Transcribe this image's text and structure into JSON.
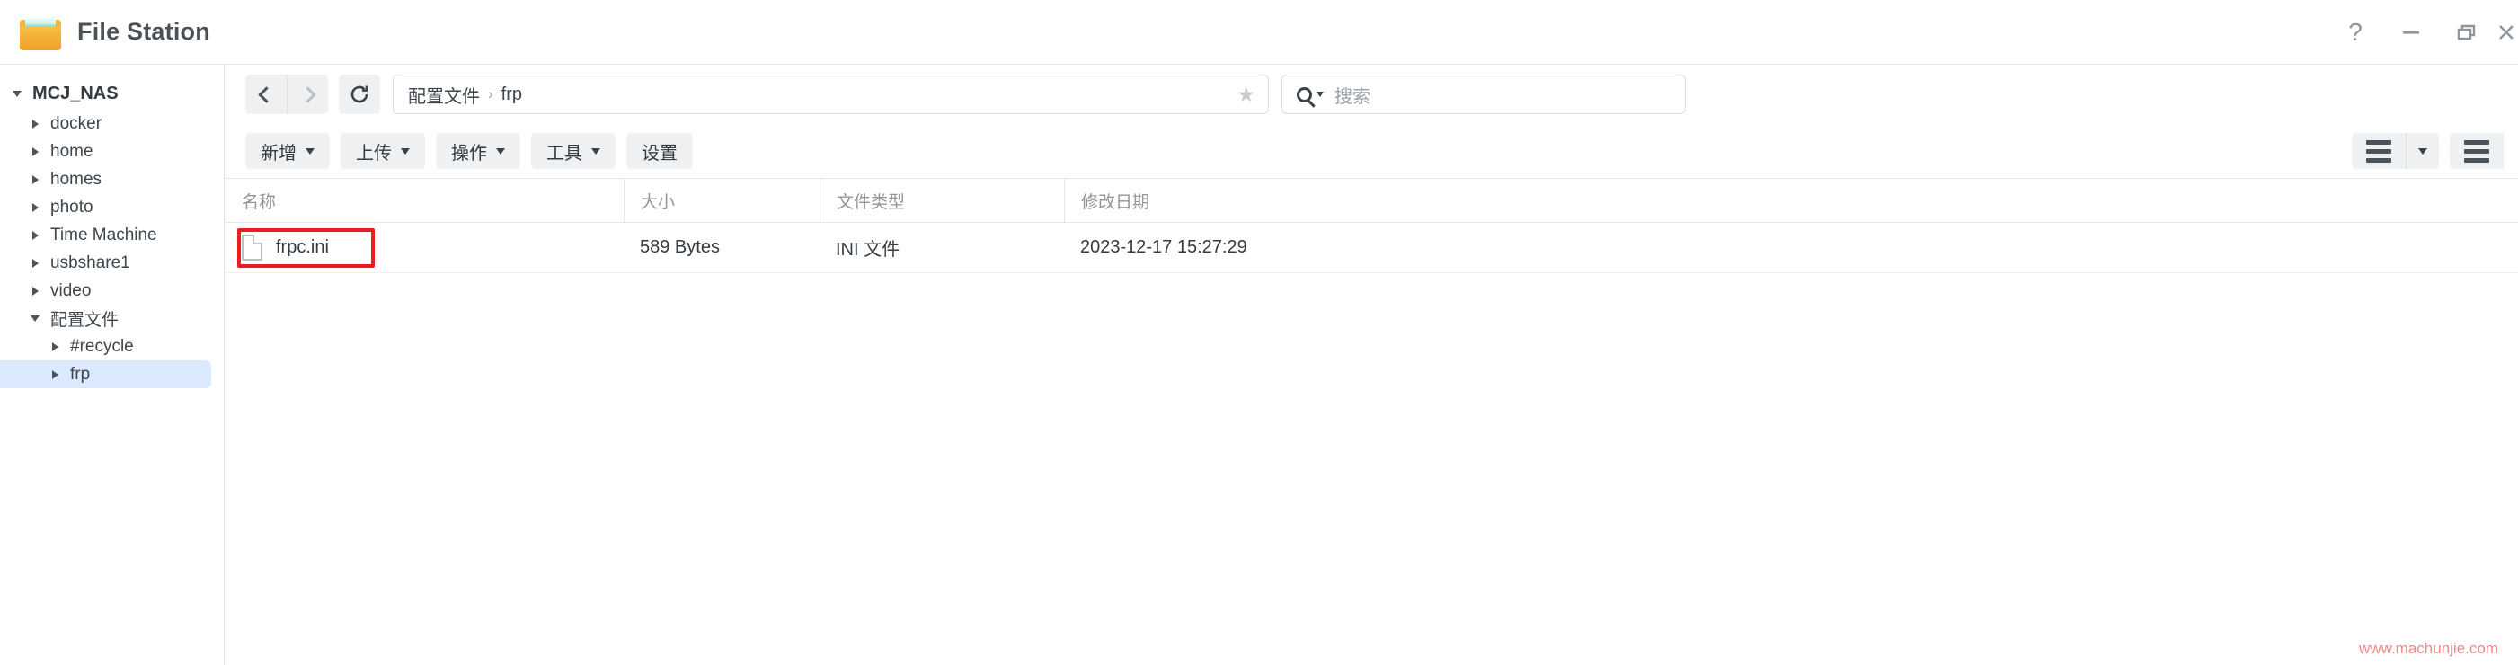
{
  "window": {
    "title": "File Station",
    "app_icon": "folder-icon",
    "controls": [
      {
        "name": "help-button",
        "glyph": "?"
      },
      {
        "name": "minimize-button",
        "glyph": "—"
      },
      {
        "name": "restore-button",
        "glyph": "restore"
      },
      {
        "name": "close-button",
        "glyph": "×"
      }
    ]
  },
  "sidebar": {
    "root": {
      "label": "MCJ_NAS",
      "expanded": true
    },
    "items": [
      {
        "label": "docker",
        "level": 1,
        "expanded": false,
        "selected": false
      },
      {
        "label": "home",
        "level": 1,
        "expanded": false,
        "selected": false
      },
      {
        "label": "homes",
        "level": 1,
        "expanded": false,
        "selected": false
      },
      {
        "label": "photo",
        "level": 1,
        "expanded": false,
        "selected": false
      },
      {
        "label": "Time Machine",
        "level": 1,
        "expanded": false,
        "selected": false
      },
      {
        "label": "usbshare1",
        "level": 1,
        "expanded": false,
        "selected": false
      },
      {
        "label": "video",
        "level": 1,
        "expanded": false,
        "selected": false
      },
      {
        "label": "配置文件",
        "level": 1,
        "expanded": true,
        "selected": false
      },
      {
        "label": "#recycle",
        "level": 2,
        "expanded": false,
        "selected": false
      },
      {
        "label": "frp",
        "level": 2,
        "expanded": false,
        "selected": true
      }
    ]
  },
  "navbar": {
    "back_label": "back-arrow",
    "forward_label": "forward-arrow",
    "refresh_label": "refresh-arrow",
    "breadcrumb": [
      "配置文件",
      "frp"
    ],
    "breadcrumb_separator": "›",
    "favorite_icon": "★",
    "search": {
      "placeholder": "搜索",
      "value": ""
    }
  },
  "toolbar": {
    "buttons": [
      {
        "label": "新增",
        "has_menu": true
      },
      {
        "label": "上传",
        "has_menu": true
      },
      {
        "label": "操作",
        "has_menu": true
      },
      {
        "label": "工具",
        "has_menu": true
      },
      {
        "label": "设置",
        "has_menu": false
      }
    ],
    "view_buttons": [
      {
        "name": "list-view-button",
        "has_menu": true
      },
      {
        "name": "detail-view-button",
        "has_menu": false
      }
    ]
  },
  "table": {
    "columns": [
      "名称",
      "大小",
      "文件类型",
      "修改日期"
    ],
    "rows": [
      {
        "name": "frpc.ini",
        "size": "589 Bytes",
        "type": "INI 文件",
        "modified": "2023-12-17 15:27:29",
        "highlighted": true
      }
    ]
  },
  "watermark": "www.machunjie.com",
  "colors": {
    "accent_selected": "#dbeafe",
    "annotation_red": "#ec1c24",
    "toolbar_button": "#eef0f2",
    "watermark": "#ec8b88"
  }
}
